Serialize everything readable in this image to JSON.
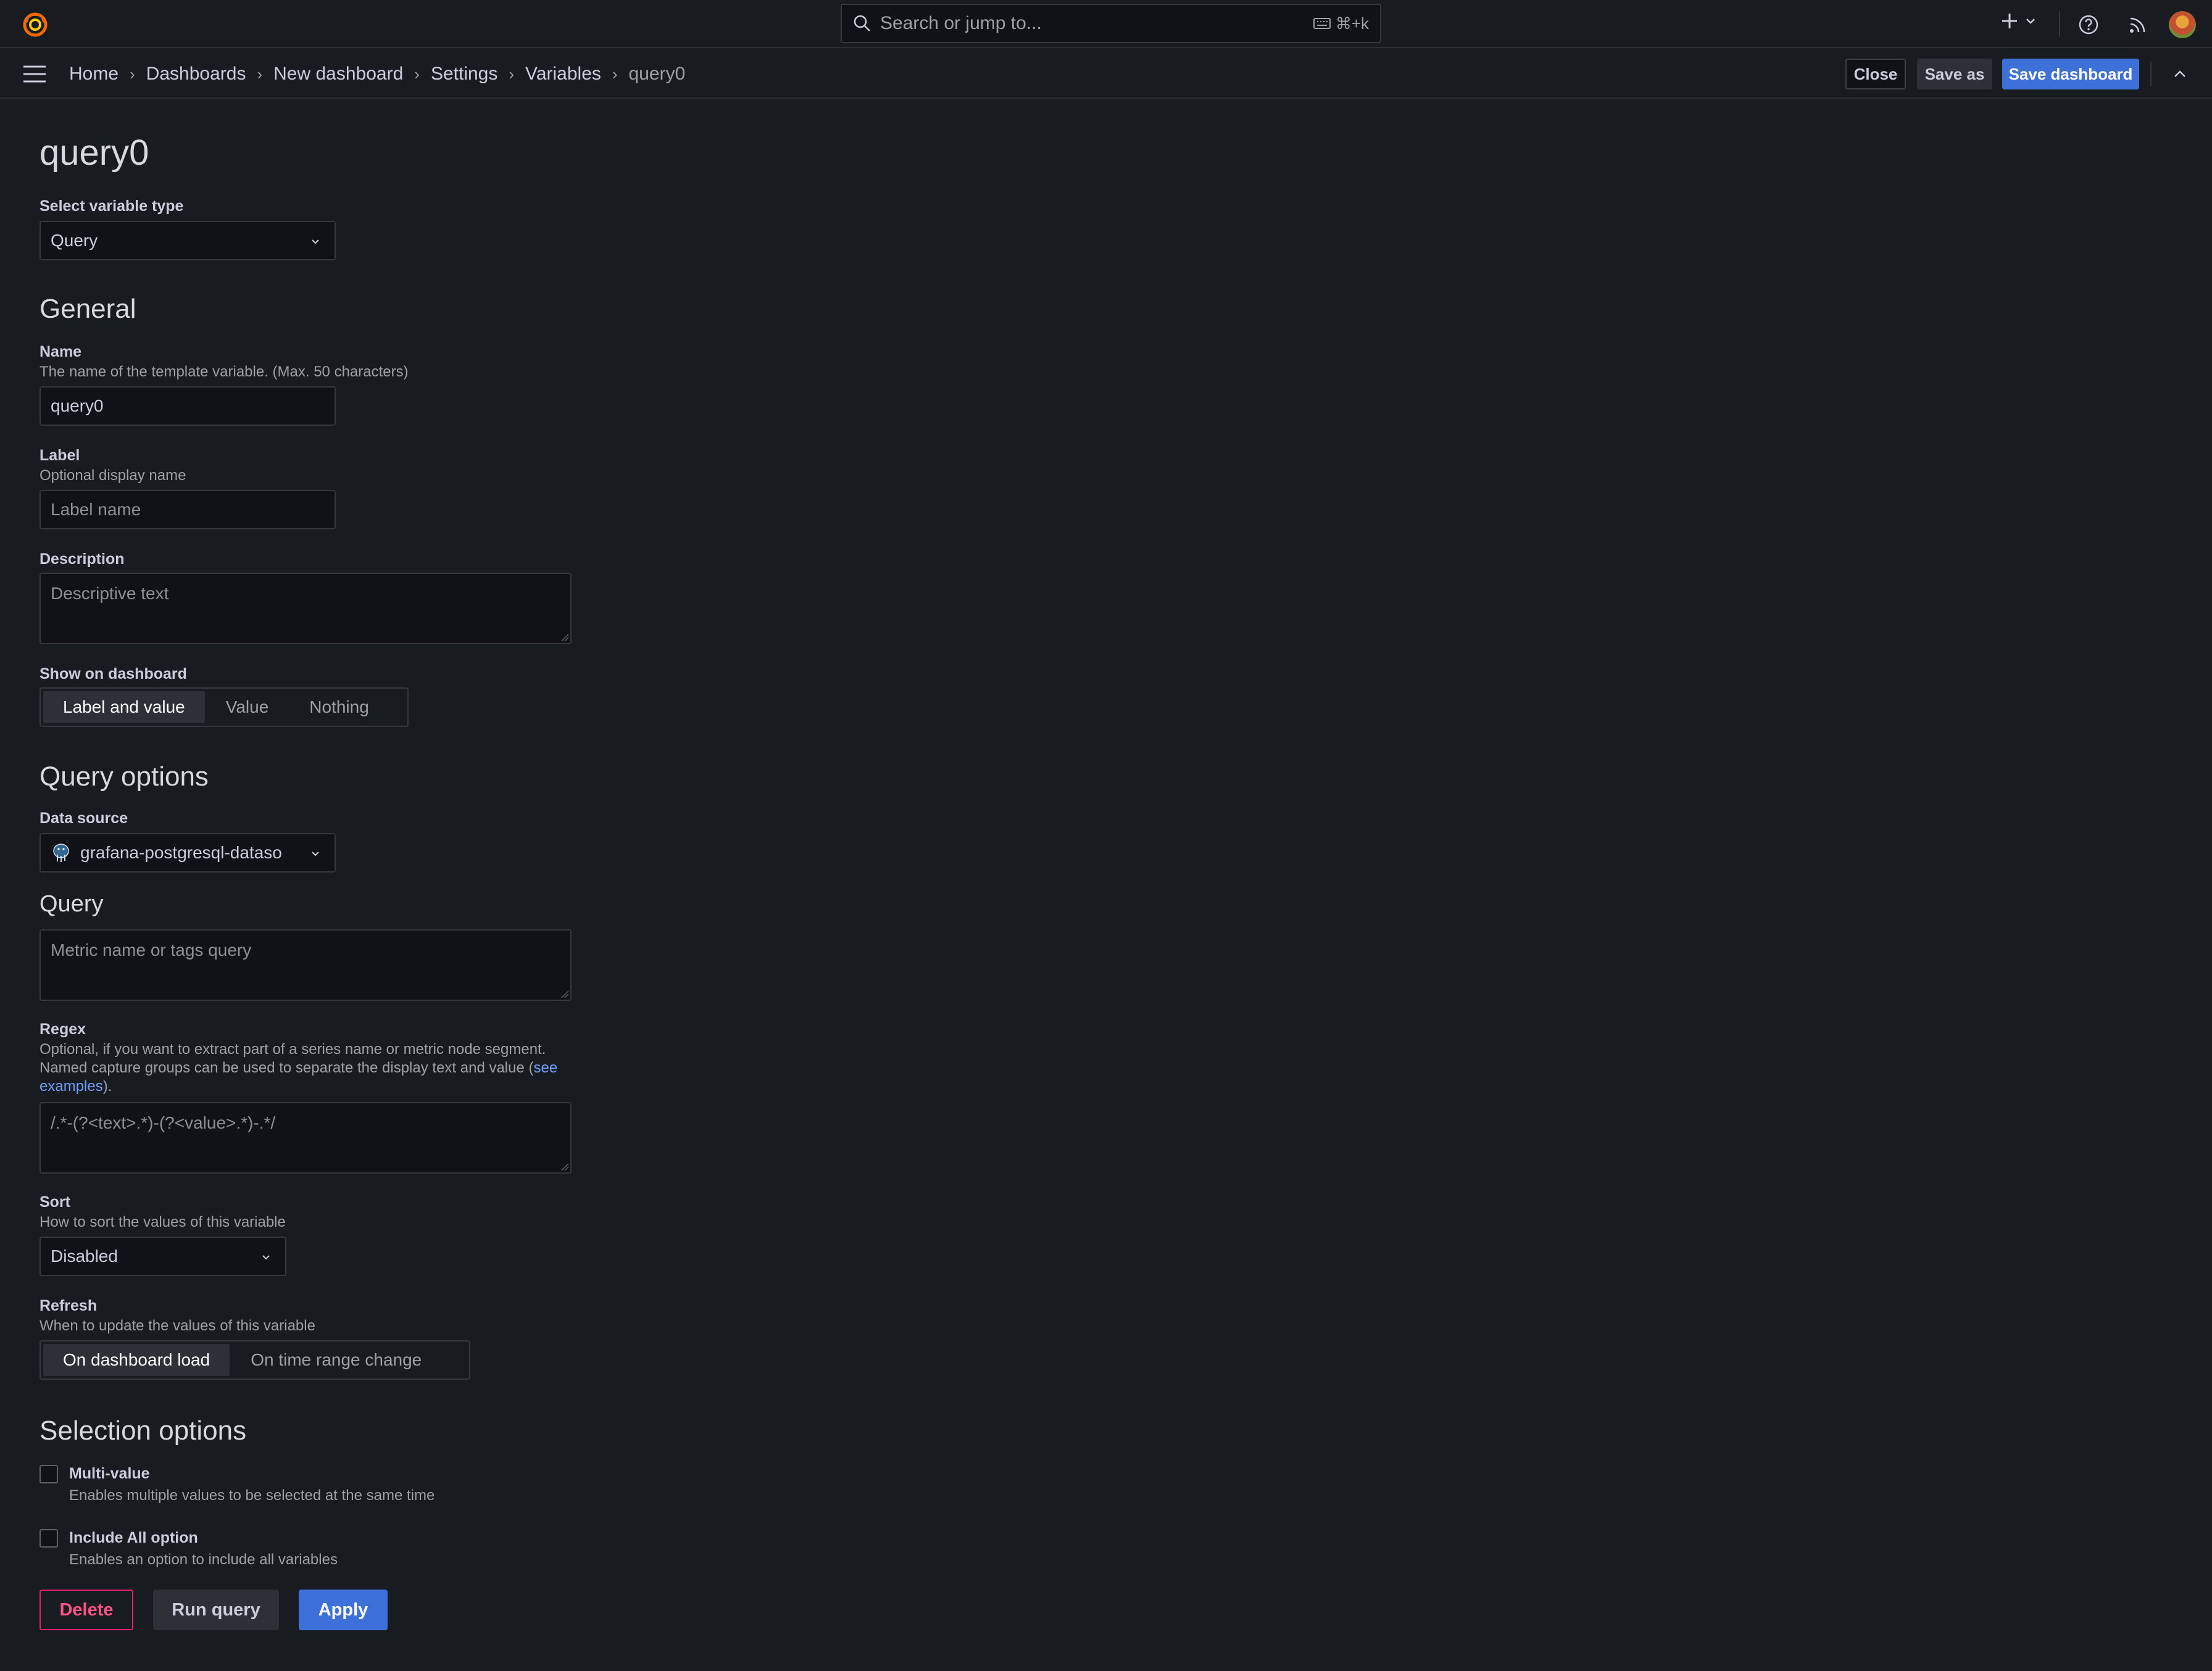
{
  "topbar": {
    "search_placeholder": "Search or jump to...",
    "search_shortcut": "⌘+k"
  },
  "breadcrumbs": [
    "Home",
    "Dashboards",
    "New dashboard",
    "Settings",
    "Variables",
    "query0"
  ],
  "nav_actions": {
    "close": "Close",
    "save_as": "Save as",
    "save_dashboard": "Save dashboard"
  },
  "page": {
    "title": "query0",
    "variable_type_label": "Select variable type",
    "variable_type_value": "Query"
  },
  "general": {
    "heading": "General",
    "name_label": "Name",
    "name_desc": "The name of the template variable. (Max. 50 characters)",
    "name_value": "query0",
    "label_label": "Label",
    "label_desc": "Optional display name",
    "label_placeholder": "Label name",
    "description_label": "Description",
    "description_placeholder": "Descriptive text",
    "show_label": "Show on dashboard",
    "show_options": [
      "Label and value",
      "Value",
      "Nothing"
    ],
    "show_selected": "Label and value"
  },
  "query_options": {
    "heading": "Query options",
    "datasource_label": "Data source",
    "datasource_value": "grafana-postgresql-dataso",
    "query_heading": "Query",
    "query_placeholder": "Metric name or tags query",
    "regex_label": "Regex",
    "regex_desc_1": "Optional, if you want to extract part of a series name or metric node segment.",
    "regex_desc_2": "Named capture groups can be used to separate the display text and value (",
    "regex_link_1": "see",
    "regex_link_2": "examples",
    "regex_desc_end": ").",
    "regex_placeholder": "/.*-(?<text>.*)-(?<value>.*)-.*/",
    "sort_label": "Sort",
    "sort_desc": "How to sort the values of this variable",
    "sort_value": "Disabled",
    "refresh_label": "Refresh",
    "refresh_desc": "When to update the values of this variable",
    "refresh_options": [
      "On dashboard load",
      "On time range change"
    ],
    "refresh_selected": "On dashboard load"
  },
  "selection_options": {
    "heading": "Selection options",
    "multi_label": "Multi-value",
    "multi_desc": "Enables multiple values to be selected at the same time",
    "multi_checked": false,
    "all_label": "Include All option",
    "all_desc": "Enables an option to include all variables",
    "all_checked": false
  },
  "actions": {
    "delete": "Delete",
    "run_query": "Run query",
    "apply": "Apply"
  },
  "colors": {
    "background": "#181b1f",
    "primary": "#3d71d9",
    "danger": "#e0226e",
    "link": "#6e9fff"
  }
}
